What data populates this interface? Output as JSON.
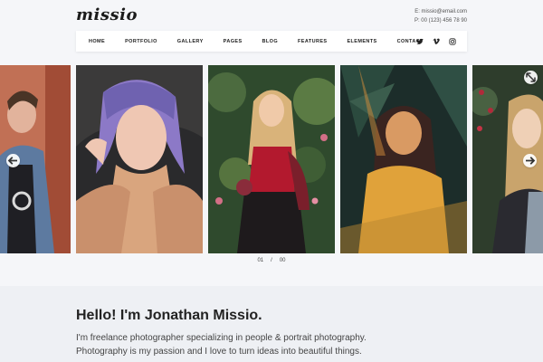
{
  "brand": {
    "logo": "missio"
  },
  "contact": {
    "email": "E: missio@email.com",
    "phone": "P: 00 (123) 456 78 90"
  },
  "nav": {
    "items": [
      "HOME",
      "PORTFOLIO",
      "GALLERY",
      "PAGES",
      "BLOG",
      "FEATURES",
      "ELEMENTS",
      "CONTACT"
    ]
  },
  "socials": [
    "twitter-icon",
    "vimeo-icon",
    "instagram-icon"
  ],
  "slider": {
    "current": "01",
    "separator": "/",
    "total": "00"
  },
  "about": {
    "title": "Hello! I'm Jonathan Missio.",
    "line1": "I'm freelance photographer specializing in people & portrait photography.",
    "line2": "Photography is my passion and I love to turn ideas into beautiful things."
  },
  "colors": {
    "background": "#f5f6f9",
    "nav_bg": "#ffffff",
    "text": "#222222",
    "about_bg": "#eef0f4"
  }
}
